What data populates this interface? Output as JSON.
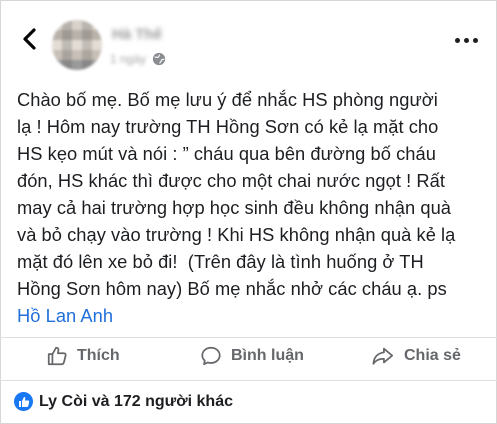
{
  "header": {
    "name": "Hà Thế",
    "meta_time": "1 ngày",
    "avatar_icon": "profile-avatar",
    "back_icon": "chevron-left-icon",
    "privacy_icon": "globe-icon",
    "more_icon": "more-dots-icon"
  },
  "post": {
    "body": "Chào bố mẹ. Bố mẹ lưu ý để nhắc HS phòng người\nlạ ! Hôm nay trường TH Hồng Sơn có kẻ lạ mặt cho\nHS kẹo mút và nói : ” cháu qua bên đường bố cháu\nđón, HS khác thì được cho một chai nước ngọt ! Rất\nmay cả hai trường hợp học sinh đều không nhận quà\nvà bỏ chạy vào trường ! Khi HS không nhận quà kẻ lạ\nmặt đó lên xe bỏ đi!  (Trên đây là tình huống ở TH\nHồng Sơn hôm nay) Bố mẹ nhắc nhở các cháu ạ. ps\n",
    "mention": "Hồ Lan Anh"
  },
  "actions": {
    "like": "Thích",
    "comment": "Bình luận",
    "share": "Chia sẻ"
  },
  "reactions": {
    "text": "Ly Còi và 172 người khác",
    "color": "#1877f2"
  },
  "colors": {
    "mention": "#216fdb",
    "action_text": "#65676b"
  }
}
